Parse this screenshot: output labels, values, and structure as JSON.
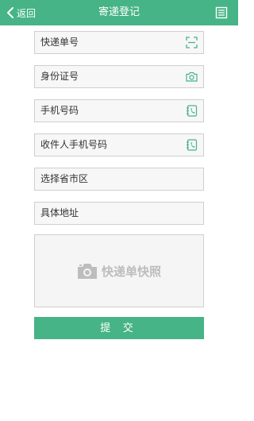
{
  "header": {
    "back_label": "返回",
    "title": "寄递登记",
    "menu_icon": "list-icon",
    "bg_color": "#46b486"
  },
  "form": {
    "tracking_number": {
      "placeholder": "快递单号",
      "icon": "scan-icon"
    },
    "id_number": {
      "placeholder": "身份证号",
      "icon": "camera-icon"
    },
    "phone": {
      "placeholder": "手机号码",
      "icon": "contact-book-icon"
    },
    "recipient_phone": {
      "placeholder": "收件人手机号码",
      "icon": "contact-book-icon"
    },
    "region": {
      "placeholder": "选择省市区"
    },
    "address": {
      "placeholder": "具体地址"
    },
    "photo": {
      "label": "快递单快照",
      "icon": "camera-icon"
    }
  },
  "submit_label": "提 交"
}
